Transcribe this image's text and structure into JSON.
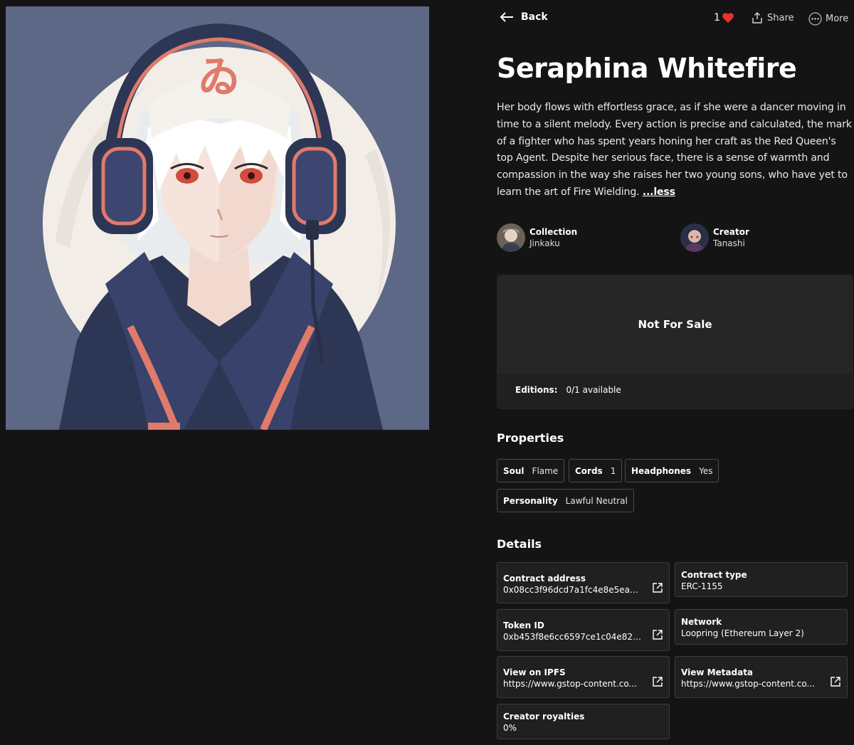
{
  "nav": {
    "back_label": "Back",
    "like_count": "1",
    "share_label": "Share",
    "more_label": "More"
  },
  "artwork": {
    "headband_glyph": "ゐ"
  },
  "item": {
    "title": "Seraphina Whitefire",
    "description": "Her body flows with effortless grace, as if she were a dancer moving in time to a silent melody. Every action is precise and calculated, the mark of a fighter who has spent years honing her craft as the Red Queen's top Agent. Despite her serious face, there is a sense of warmth and compassion in the way she raises her two young sons, who have yet to learn the art of Fire Wielding.",
    "less_label": "...less"
  },
  "collection": {
    "label": "Collection",
    "value": "Jinkaku"
  },
  "creator": {
    "label": "Creator",
    "value": "Tanashi"
  },
  "sale": {
    "status": "Not For Sale",
    "editions_label": "Editions:",
    "editions_value": "0/1 available"
  },
  "properties": {
    "heading": "Properties",
    "items": [
      {
        "key": "Soul",
        "value": "Flame"
      },
      {
        "key": "Cords",
        "value": "1"
      },
      {
        "key": "Headphones",
        "value": "Yes"
      },
      {
        "key": "Personality",
        "value": "Lawful Neutral"
      }
    ]
  },
  "details": {
    "heading": "Details",
    "items": [
      {
        "key": "Contract address",
        "value": "0x08cc3f96dcd7a1fc4e8e5eac..."
      },
      {
        "key": "Contract type",
        "value": "ERC-1155"
      },
      {
        "key": "Token ID",
        "value": "0xb453f8e6cc6597ce1c04e82d..."
      },
      {
        "key": "Network",
        "value": "Loopring (Ethereum Layer 2)"
      },
      {
        "key": "View on IPFS",
        "value": "https://www.gstop-content.co..."
      },
      {
        "key": "View Metadata",
        "value": "https://www.gstop-content.co..."
      },
      {
        "key": "Creator royalties",
        "value": "0%"
      }
    ]
  },
  "colors": {
    "background": "#141414",
    "art_background": "#5d6786",
    "heart": "#e5322d",
    "card": "#202020"
  }
}
